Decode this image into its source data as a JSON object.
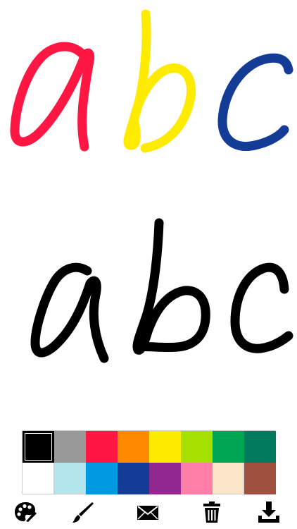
{
  "app": {
    "canvas_background": "#FFFFFF"
  },
  "drawing": {
    "strokes": [
      {
        "name": "red-a",
        "color": "#FF1744"
      },
      {
        "name": "yellow-b",
        "color": "#FFEB00"
      },
      {
        "name": "blue-c",
        "color": "#143C96"
      },
      {
        "name": "black-a",
        "color": "#000000"
      },
      {
        "name": "black-b",
        "color": "#000000"
      },
      {
        "name": "black-c",
        "color": "#000000"
      }
    ]
  },
  "palette": {
    "selected_index": 0,
    "colors": [
      "#000000",
      "#999999",
      "#FF1744",
      "#FF8A00",
      "#FFEB00",
      "#A6E000",
      "#00A651",
      "#007B5E",
      "#FFFFFF",
      "#B3E5EC",
      "#0099E0",
      "#143C96",
      "#92278F",
      "#FF7FA8",
      "#FCE4C8",
      "#A0503F"
    ]
  },
  "toolbar": {
    "items": [
      {
        "icon": "palette-icon"
      },
      {
        "icon": "brush-icon"
      },
      {
        "icon": "envelope-icon"
      },
      {
        "icon": "trash-icon"
      },
      {
        "icon": "download-icon"
      }
    ]
  }
}
